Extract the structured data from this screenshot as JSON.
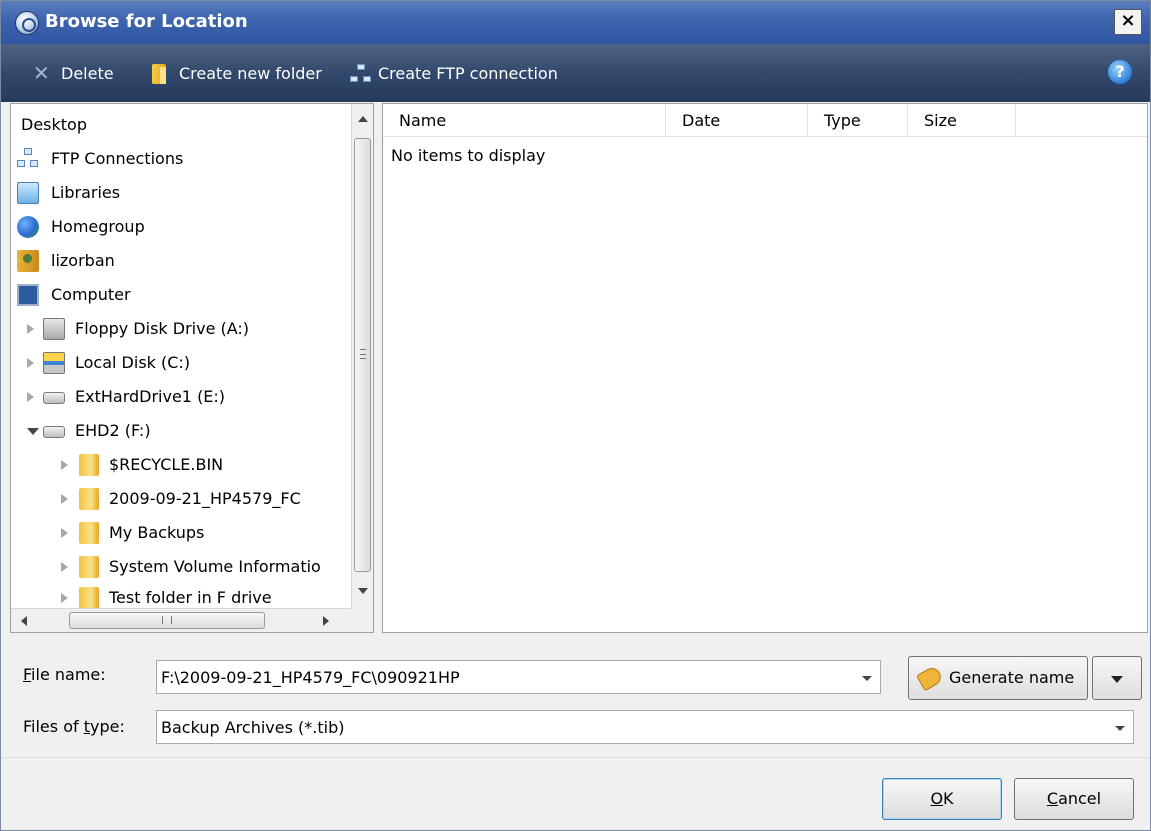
{
  "window": {
    "title": "Browse for Location",
    "close_label": "×"
  },
  "toolbar": {
    "delete_label": "Delete",
    "new_folder_label": "Create new folder",
    "ftp_label": "Create FTP connection",
    "help_label": "?"
  },
  "tree": {
    "items": [
      {
        "label": "Desktop",
        "icon": "desktop"
      },
      {
        "label": "FTP Connections",
        "icon": "ftp-connections-icon"
      },
      {
        "label": "Libraries",
        "icon": "libraries-icon"
      },
      {
        "label": "Homegroup",
        "icon": "homegroup-icon"
      },
      {
        "label": "lizorban",
        "icon": "user-folder-icon"
      },
      {
        "label": "Computer",
        "icon": "computer-icon"
      },
      {
        "label": "Floppy Disk Drive (A:)",
        "icon": "floppy-drive-icon"
      },
      {
        "label": "Local Disk (C:)",
        "icon": "local-disk-icon"
      },
      {
        "label": "ExtHardDrive1 (E:)",
        "icon": "hard-drive-icon"
      },
      {
        "label": "EHD2 (F:)",
        "icon": "hard-drive-icon"
      },
      {
        "label": "$RECYCLE.BIN",
        "icon": "folder-icon"
      },
      {
        "label": "2009-09-21_HP4579_FC",
        "icon": "folder-icon"
      },
      {
        "label": "My Backups",
        "icon": "folder-icon"
      },
      {
        "label": "System Volume Informatio",
        "icon": "folder-icon"
      },
      {
        "label": "Test folder in F drive",
        "icon": "folder-icon"
      }
    ],
    "hscroll_grip": "III"
  },
  "list": {
    "columns": [
      "Name",
      "Date",
      "Type",
      "Size"
    ],
    "empty_message": "No items to display"
  },
  "form": {
    "file_name_label_accel": "F",
    "file_name_label_rest": "ile name:",
    "file_name_value": "F:\\2009-09-21_HP4579_FC\\090921HP",
    "file_type_label_pre": "Files of ",
    "file_type_label_accel": "t",
    "file_type_label_rest": "ype:",
    "file_type_value": "Backup Archives (*.tib)",
    "generate_label": "Generate name"
  },
  "buttons": {
    "ok_accel": "O",
    "ok_rest": "K",
    "cancel_accel": "C",
    "cancel_rest": "ancel"
  },
  "colors": {
    "title_bar": "#3d63ad",
    "toolbar": "#32496b",
    "window_bg": "#f0f0f0"
  }
}
